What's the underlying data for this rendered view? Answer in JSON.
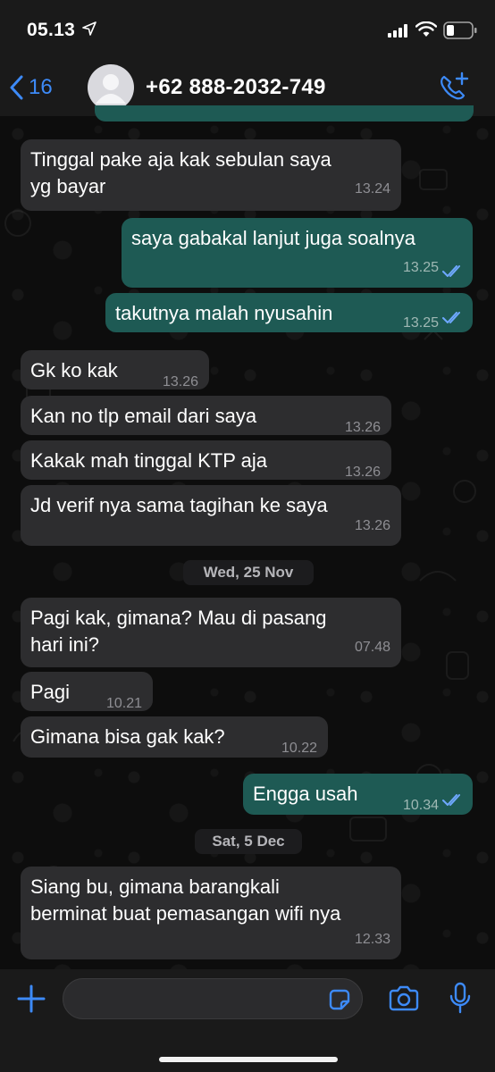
{
  "status_bar": {
    "time": "05.13",
    "icons": [
      "location-arrow-icon",
      "signal-icon",
      "wifi-icon",
      "battery-icon"
    ]
  },
  "header": {
    "back_count": "16",
    "contact": "+62 888-2032-749",
    "icons": [
      "back-chevron-icon",
      "avatar-placeholder-icon",
      "add-call-icon"
    ]
  },
  "colors": {
    "accent": "#3d8af7",
    "incoming_bubble": "#2d2d2f",
    "outgoing_bubble": "#1e5a54",
    "read_ticks": "#6fa8ff"
  },
  "messages": [
    {
      "dir": "in",
      "text": "Tinggal pake aja kak sebulan saya\nyg bayar",
      "time": "13.24"
    },
    {
      "dir": "out",
      "text": "saya gabakal lanjut juga soalnya",
      "time": "13.25",
      "status": "read"
    },
    {
      "dir": "out",
      "text": "takutnya malah nyusahin",
      "time": "13.25",
      "status": "read"
    },
    {
      "dir": "in",
      "text": "Gk ko kak",
      "time": "13.26"
    },
    {
      "dir": "in",
      "text": "Kan no tlp email dari saya",
      "time": "13.26"
    },
    {
      "dir": "in",
      "text": "Kakak mah tinggal KTP aja",
      "time": "13.26"
    },
    {
      "dir": "in",
      "text": "Jd verif nya sama tagihan ke saya",
      "time": "13.26"
    },
    {
      "dir": "in",
      "text": "Pagi kak, gimana? Mau di pasang\nhari ini?",
      "time": "07.48"
    },
    {
      "dir": "in",
      "text": "Pagi",
      "time": "10.21"
    },
    {
      "dir": "in",
      "text": "Gimana bisa gak kak?",
      "time": "10.22"
    },
    {
      "dir": "out",
      "text": "Engga usah",
      "time": "10.34",
      "status": "read"
    },
    {
      "dir": "in",
      "text": "Siang bu, gimana barangkali\nberminat buat pemasangan wifi nya",
      "time": "12.33"
    }
  ],
  "date_separators": [
    "Wed, 25 Nov",
    "Sat, 5 Dec"
  ],
  "input": {
    "value": "",
    "icons": [
      "plus-icon",
      "sticker-icon",
      "camera-icon",
      "microphone-icon"
    ]
  }
}
